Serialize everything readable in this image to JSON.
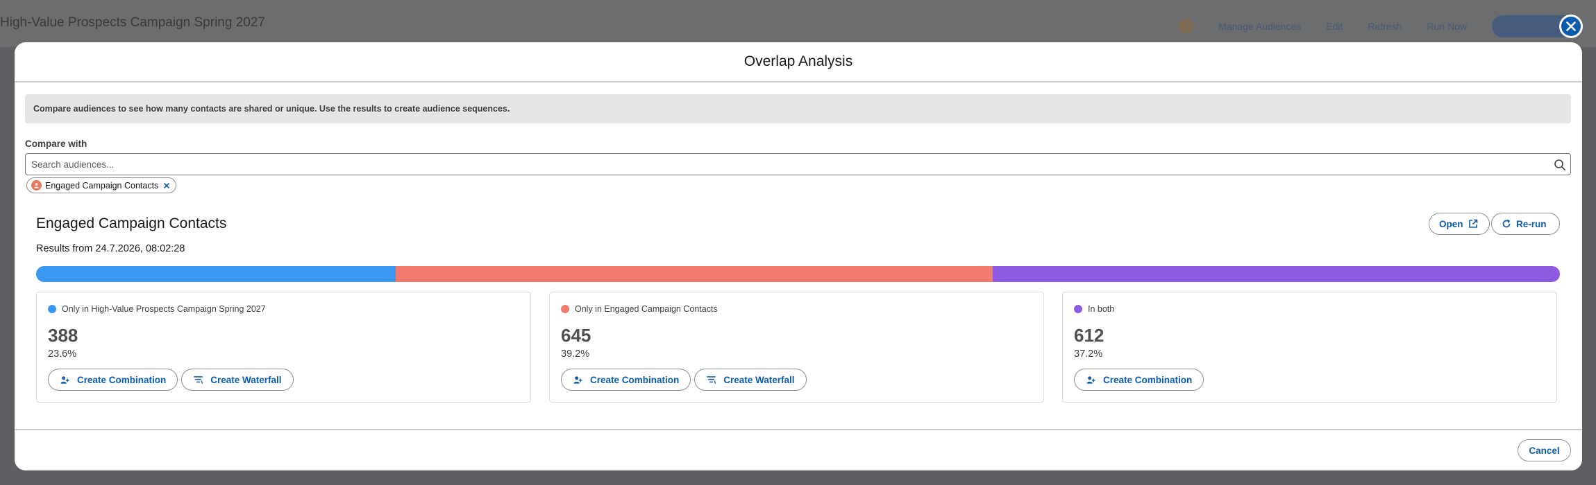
{
  "background": {
    "page_title": "High-Value Prospects Campaign Spring 2027",
    "actions": [
      "Manage Audiences",
      "Edit",
      "Refresh",
      "Run Now"
    ]
  },
  "modal": {
    "title": "Overlap Analysis",
    "info_text": "Compare audiences to see how many contacts are shared or unique. Use the results to create audience sequences.",
    "compare_label": "Compare with",
    "search_placeholder": "Search audiences...",
    "selected_audience": "Engaged Campaign Contacts",
    "result_title": "Engaged Campaign Contacts",
    "result_date": "Results from 24.7.2026, 08:02:28",
    "open_label": "Open",
    "rerun_label": "Re-run",
    "cancel_label": "Cancel"
  },
  "overlap": {
    "segments": [
      {
        "label": "Only in High-Value Prospects Campaign Spring 2027",
        "count": "388",
        "percent": "23.6%",
        "fraction": 0.236,
        "color": "#3a97f2",
        "actions": [
          "Create Combination",
          "Create Waterfall"
        ]
      },
      {
        "label": "Only in Engaged Campaign Contacts",
        "count": "645",
        "percent": "39.2%",
        "fraction": 0.392,
        "color": "#f27a6e",
        "actions": [
          "Create Combination",
          "Create Waterfall"
        ]
      },
      {
        "label": "In both",
        "count": "612",
        "percent": "37.2%",
        "fraction": 0.372,
        "color": "#8c5be0",
        "actions": [
          "Create Combination"
        ]
      }
    ]
  },
  "icons": {
    "close": "close-icon",
    "search": "search-icon",
    "open": "external-link-icon",
    "rerun": "refresh-icon",
    "combination": "users-icon",
    "waterfall": "waterfall-icon"
  }
}
